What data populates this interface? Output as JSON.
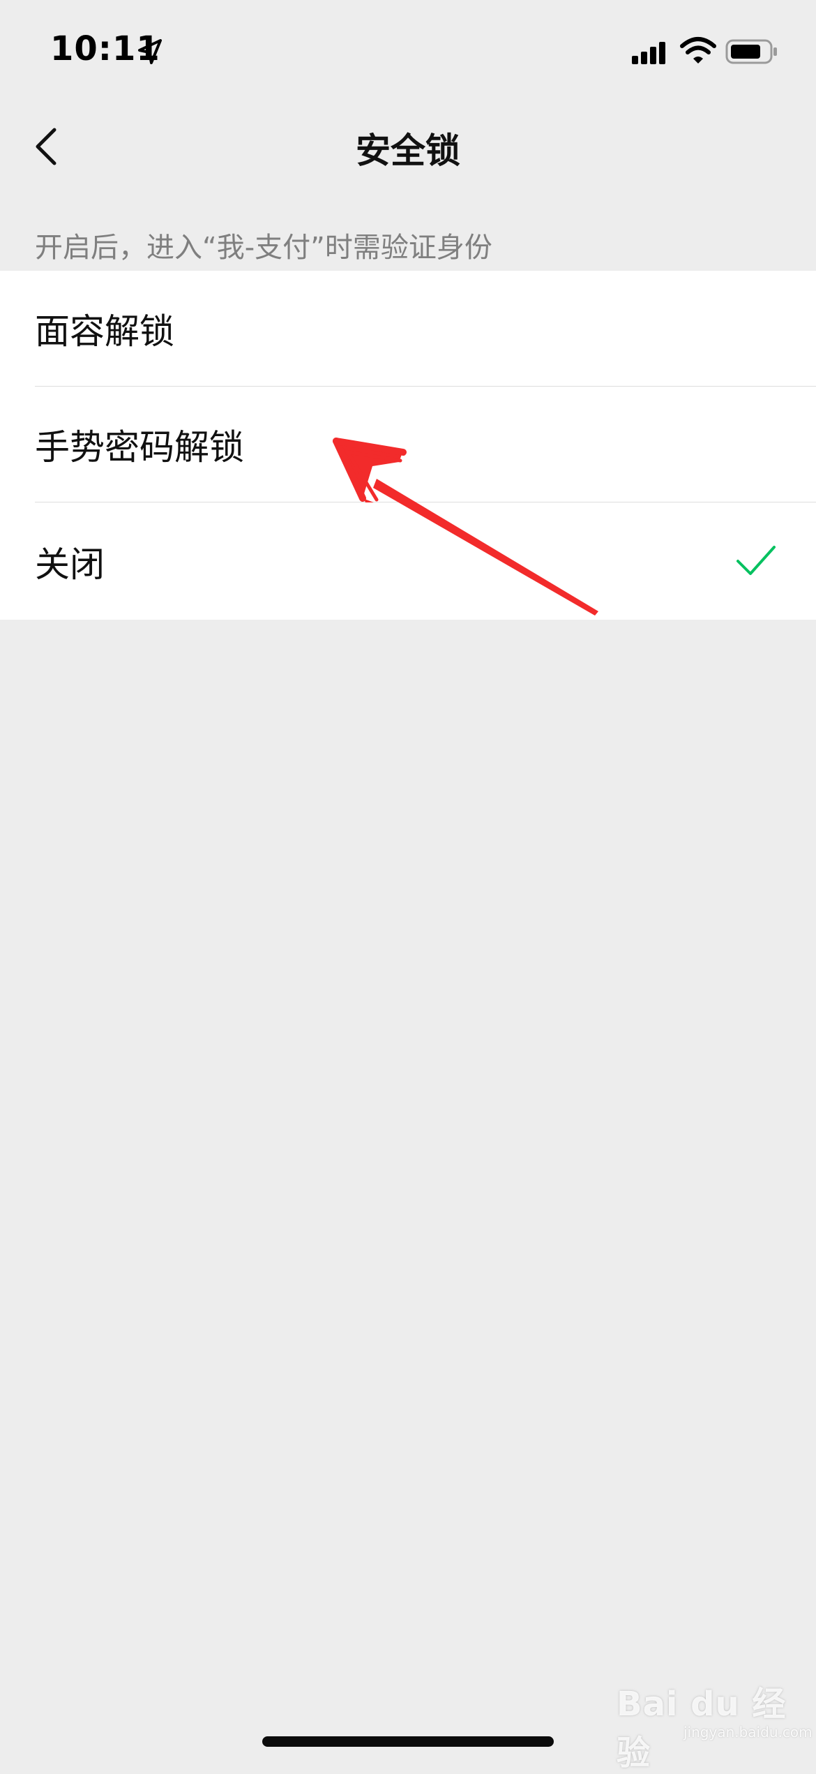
{
  "status_bar": {
    "time": "10:11",
    "icons": [
      "location-arrow-icon",
      "cellular-signal-icon",
      "wifi-icon",
      "battery-icon"
    ]
  },
  "nav": {
    "title": "安全锁",
    "back_icon": "chevron-left-icon"
  },
  "hint": "开启后，进入“我-支付”时需验证身份",
  "options": [
    {
      "label": "面容解锁",
      "selected": false
    },
    {
      "label": "手势密码解锁",
      "selected": false
    },
    {
      "label": "关闭",
      "selected": true
    }
  ],
  "colors": {
    "background": "#ededed",
    "card": "#ffffff",
    "check": "#07c160",
    "annotation": "#f22b2b"
  },
  "watermark": {
    "brand": "Bai du 经验",
    "url": "jingyan.baidu.com"
  }
}
